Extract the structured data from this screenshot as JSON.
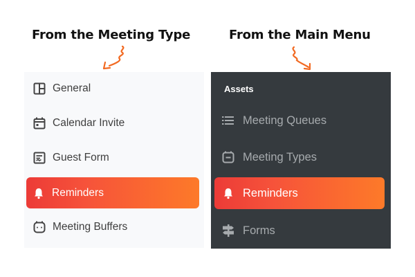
{
  "headings": {
    "left": "From the Meeting Type",
    "right": "From the Main Menu"
  },
  "meeting_type_menu": {
    "items": [
      {
        "label": "General",
        "icon": "layout-icon",
        "active": false
      },
      {
        "label": "Calendar Invite",
        "icon": "calendar-icon",
        "active": false
      },
      {
        "label": "Guest Form",
        "icon": "form-icon",
        "active": false
      },
      {
        "label": "Reminders",
        "icon": "bell-icon",
        "active": true
      },
      {
        "label": "Meeting Buffers",
        "icon": "buffer-clock-icon",
        "active": false
      }
    ]
  },
  "main_menu": {
    "section_label": "Assets",
    "items": [
      {
        "label": "Meeting Queues",
        "icon": "list-icon",
        "active": false
      },
      {
        "label": "Meeting Types",
        "icon": "meeting-type-icon",
        "active": false
      },
      {
        "label": "Reminders",
        "icon": "bell-icon",
        "active": true
      },
      {
        "label": "Forms",
        "icon": "signpost-icon",
        "active": false
      }
    ]
  },
  "colors": {
    "accent_gradient_start": "#ec3b37",
    "accent_gradient_end": "#fd7a29",
    "arrow": "#f26a22",
    "dark_panel": "#353a3e",
    "light_panel": "#f8f9fb"
  }
}
